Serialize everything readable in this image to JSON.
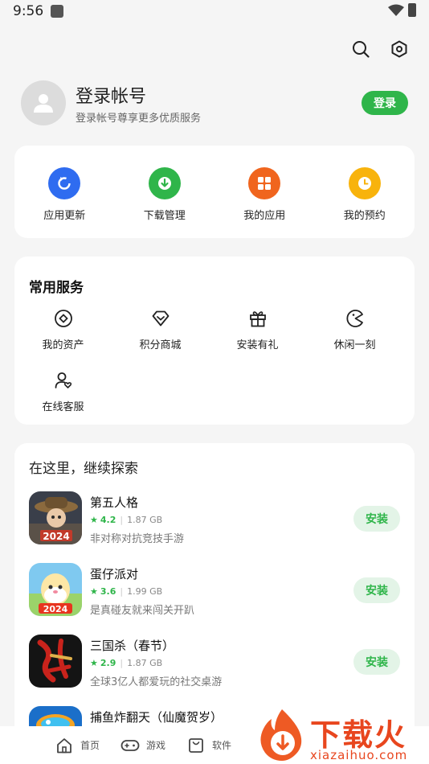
{
  "status_bar": {
    "time": "9:56"
  },
  "profile": {
    "title": "登录帐号",
    "subtitle": "登录帐号尊享更多优质服务",
    "login_label": "登录"
  },
  "quick_actions": [
    {
      "label": "应用更新",
      "icon": "refresh-icon",
      "color": "#2f6cf0"
    },
    {
      "label": "下载管理",
      "icon": "download-icon",
      "color": "#2fb54a"
    },
    {
      "label": "我的应用",
      "icon": "grid-icon",
      "color": "#f0651e"
    },
    {
      "label": "我的预约",
      "icon": "clock-icon",
      "color": "#f8b30c"
    }
  ],
  "services": {
    "title": "常用服务",
    "items": [
      {
        "label": "我的资产",
        "icon": "coin-icon"
      },
      {
        "label": "积分商城",
        "icon": "diamond-icon"
      },
      {
        "label": "安装有礼",
        "icon": "gift-icon"
      },
      {
        "label": "休闲一刻",
        "icon": "pacman-icon"
      },
      {
        "label": "在线客服",
        "icon": "support-icon"
      }
    ]
  },
  "explore": {
    "title": "在这里，继续探索",
    "apps": [
      {
        "name": "第五人格",
        "rating": "4.2",
        "size": "1.87 GB",
        "desc": "非对称对抗竞技手游",
        "install_label": "安装"
      },
      {
        "name": "蛋仔派对",
        "rating": "3.6",
        "size": "1.99 GB",
        "desc": "是真碰友就来闯关开趴",
        "install_label": "安装"
      },
      {
        "name": "三国杀（春节）",
        "rating": "2.9",
        "size": "1.87 GB",
        "desc": "全球3亿人都爱玩的社交桌游",
        "install_label": "安装"
      },
      {
        "name": "捕鱼炸翻天（仙魔贺岁）"
      }
    ]
  },
  "bottom_nav": [
    {
      "label": "首页",
      "icon": "home-icon"
    },
    {
      "label": "游戏",
      "icon": "gamepad-icon"
    },
    {
      "label": "软件",
      "icon": "bag-icon"
    }
  ],
  "watermark": {
    "text": "下载火",
    "url": "xiazaihuo.com"
  },
  "colors": {
    "accent": "#2fb54a",
    "install_bg": "#e3f4e7"
  }
}
